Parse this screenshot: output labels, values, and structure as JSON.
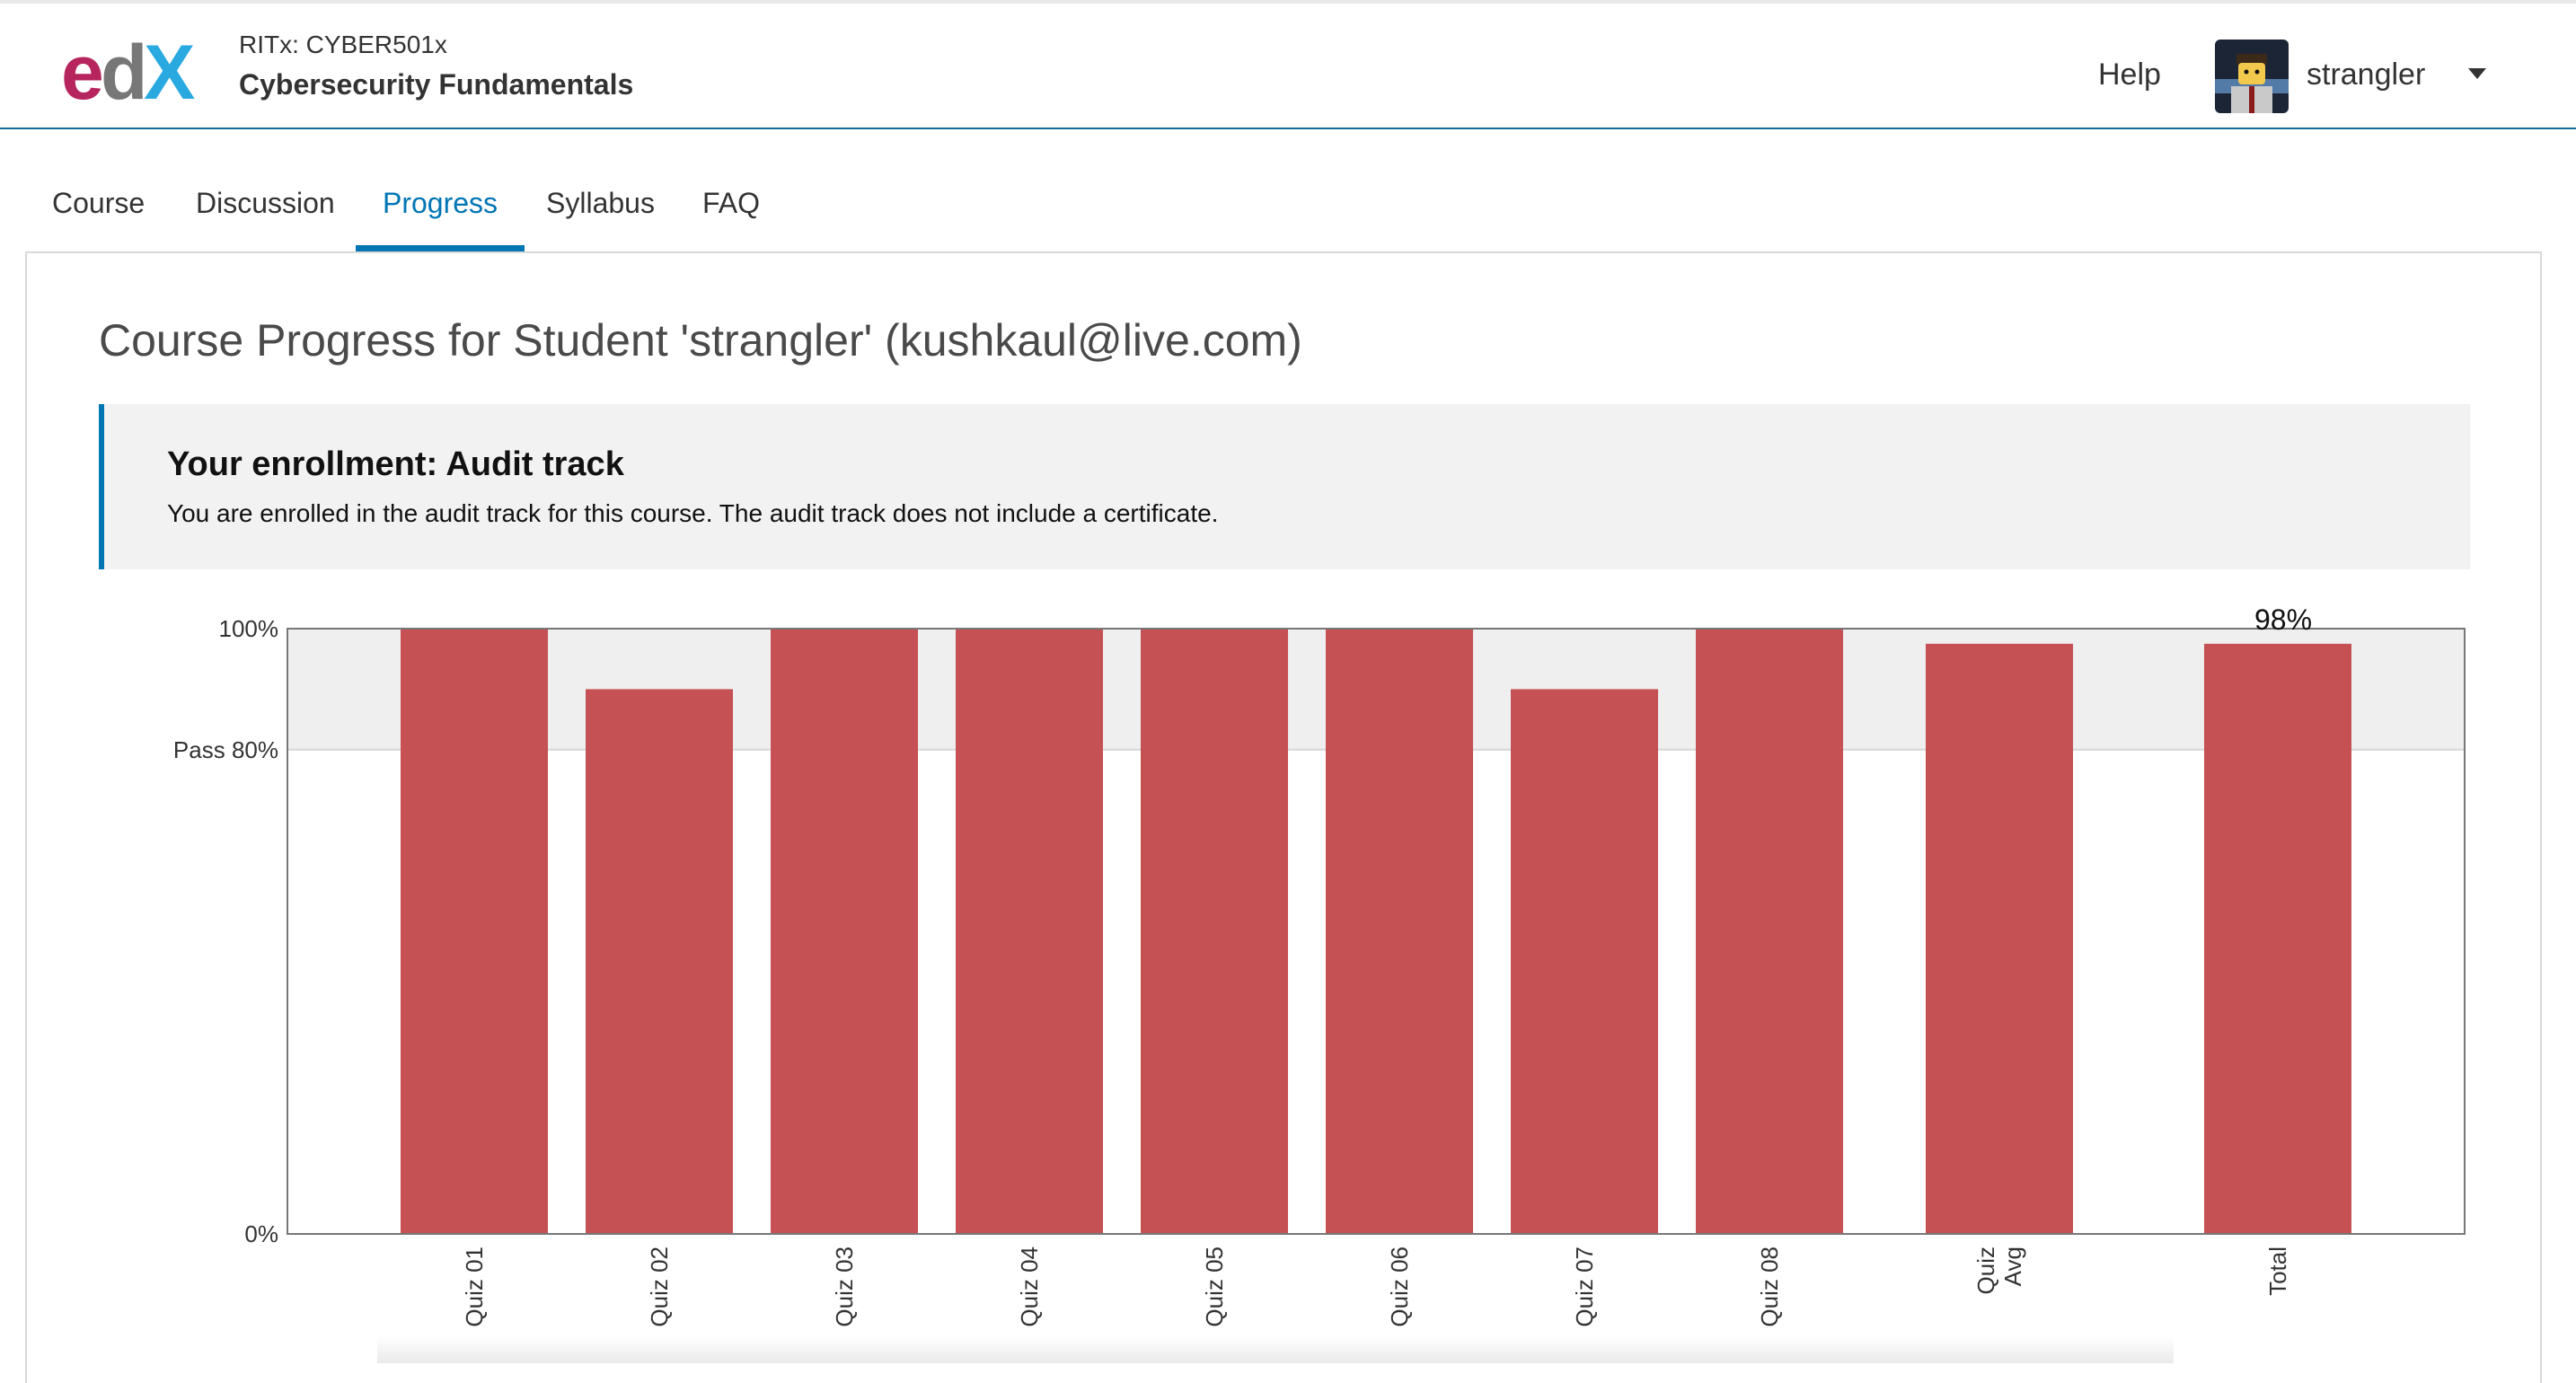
{
  "header": {
    "logo_text": "edX",
    "course_org": "RITx: CYBER501x",
    "course_name": "Cybersecurity Fundamentals",
    "help_label": "Help",
    "username": "strangler"
  },
  "tabs": [
    {
      "label": "Course"
    },
    {
      "label": "Discussion"
    },
    {
      "label": "Progress",
      "active": true
    },
    {
      "label": "Syllabus"
    },
    {
      "label": "FAQ"
    }
  ],
  "main": {
    "title": "Course Progress for Student 'strangler' (kushkaul@live.com)",
    "enrollment": {
      "title": "Your enrollment: Audit track",
      "message": "You are enrolled in the audit track for this course. The audit track does not include a certificate."
    }
  },
  "colors": {
    "accent": "#0075b4",
    "bar": "#c44e52",
    "pass_band": "#efefef"
  },
  "chart_data": {
    "type": "bar",
    "categories": [
      "Quiz 01",
      "Quiz 02",
      "Quiz 03",
      "Quiz 04",
      "Quiz 05",
      "Quiz 06",
      "Quiz 07",
      "Quiz 08",
      "Quiz Avg",
      "Total"
    ],
    "category_lines": [
      [
        "Quiz 01"
      ],
      [
        "Quiz 02"
      ],
      [
        "Quiz 03"
      ],
      [
        "Quiz 04"
      ],
      [
        "Quiz 05"
      ],
      [
        "Quiz 06"
      ],
      [
        "Quiz 07"
      ],
      [
        "Quiz 08"
      ],
      [
        "Quiz",
        "Avg"
      ],
      [
        "Total"
      ]
    ],
    "values": [
      100,
      90,
      100,
      100,
      100,
      100,
      90,
      100,
      97.5,
      97.5
    ],
    "ylim": [
      0,
      100
    ],
    "y_ticks": [
      {
        "value": 100,
        "label": "100%"
      },
      {
        "value": 80,
        "label": "Pass 80%"
      },
      {
        "value": 0,
        "label": "0%"
      }
    ],
    "pass_threshold": 80,
    "total_label": "98%"
  }
}
